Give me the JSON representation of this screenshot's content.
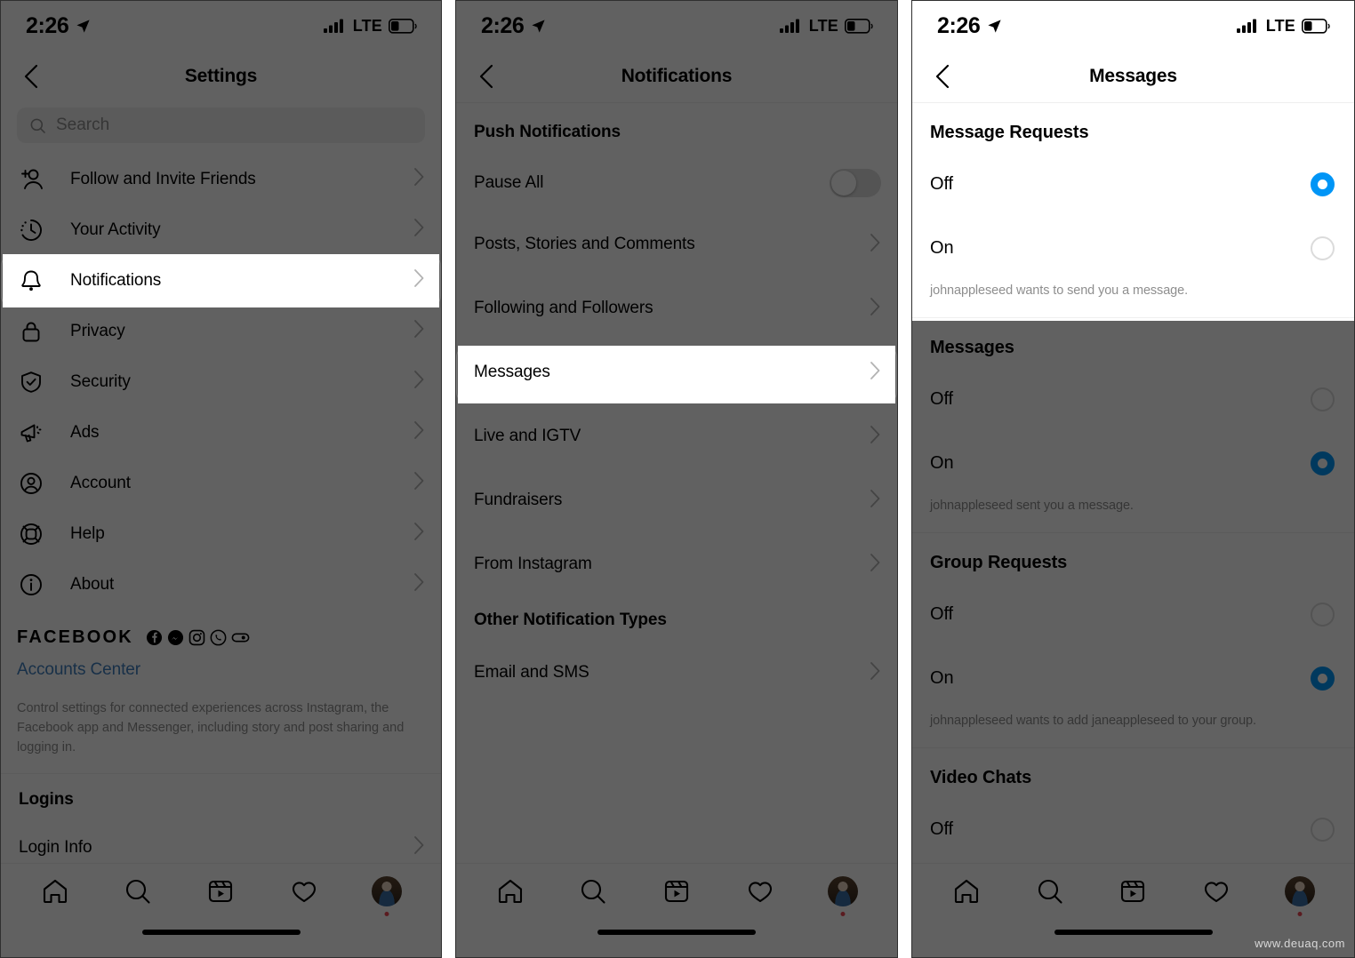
{
  "meta": {
    "watermark": "www.deuaq.com"
  },
  "status_bar": {
    "time": "2:26",
    "network": "LTE",
    "location_icon": "location-arrow-icon",
    "signal_icon": "cellular-signal-icon",
    "battery_icon": "battery-icon"
  },
  "colors": {
    "accent_blue": "#0095f6",
    "link_blue": "#3f7ebd",
    "muted_text": "#8e8e8e",
    "divider": "#efefef",
    "field_bg": "#efefef",
    "notification_dot": "#ed4956",
    "dim_overlay": "#000000"
  },
  "tab_bar": {
    "items": [
      {
        "name": "home",
        "icon": "home-icon"
      },
      {
        "name": "search",
        "icon": "search-icon"
      },
      {
        "name": "reels",
        "icon": "reels-icon"
      },
      {
        "name": "activity",
        "icon": "heart-icon"
      },
      {
        "name": "profile",
        "icon": "avatar-icon",
        "has_badge": true
      }
    ]
  },
  "panel1": {
    "nav": {
      "title": "Settings",
      "back_icon": "chevron-left-icon"
    },
    "search": {
      "placeholder": "Search",
      "icon": "search-icon"
    },
    "items": [
      {
        "label": "Follow and Invite Friends",
        "icon": "add-person-icon",
        "highlighted": false
      },
      {
        "label": "Your Activity",
        "icon": "activity-clock-icon",
        "highlighted": false
      },
      {
        "label": "Notifications",
        "icon": "bell-icon",
        "highlighted": true
      },
      {
        "label": "Privacy",
        "icon": "lock-icon",
        "highlighted": false
      },
      {
        "label": "Security",
        "icon": "shield-check-icon",
        "highlighted": false
      },
      {
        "label": "Ads",
        "icon": "megaphone-icon",
        "highlighted": false
      },
      {
        "label": "Account",
        "icon": "account-circle-icon",
        "highlighted": false
      },
      {
        "label": "Help",
        "icon": "lifebuoy-icon",
        "highlighted": false
      },
      {
        "label": "About",
        "icon": "info-circle-icon",
        "highlighted": false
      }
    ],
    "facebook": {
      "word": "FACEBOOK",
      "icons": [
        "facebook-icon",
        "messenger-icon",
        "instagram-icon",
        "whatsapp-icon",
        "portal-icon"
      ],
      "accounts_center_link": "Accounts Center",
      "description": "Control settings for connected experiences across Instagram, the Facebook app and Messenger, including story and post sharing and logging in."
    },
    "logins": {
      "header": "Logins",
      "items": [
        {
          "label": "Login Info"
        }
      ]
    }
  },
  "panel2": {
    "nav": {
      "title": "Notifications",
      "back_icon": "chevron-left-icon"
    },
    "sections": [
      {
        "header": "Push Notifications",
        "items": [
          {
            "label": "Pause All",
            "control": "toggle",
            "value": "off",
            "highlighted": false
          },
          {
            "label": "Posts, Stories and Comments",
            "control": "chevron",
            "highlighted": false
          },
          {
            "label": "Following and Followers",
            "control": "chevron",
            "highlighted": false
          },
          {
            "label": "Messages",
            "control": "chevron",
            "highlighted": true
          },
          {
            "label": "Live and IGTV",
            "control": "chevron",
            "highlighted": false
          },
          {
            "label": "Fundraisers",
            "control": "chevron",
            "highlighted": false
          },
          {
            "label": "From Instagram",
            "control": "chevron",
            "highlighted": false
          }
        ]
      },
      {
        "header": "Other Notification Types",
        "items": [
          {
            "label": "Email and SMS",
            "control": "chevron",
            "highlighted": false
          }
        ]
      }
    ]
  },
  "panel3": {
    "nav": {
      "title": "Messages",
      "back_icon": "chevron-left-icon"
    },
    "groups": [
      {
        "header": "Message Requests",
        "options": [
          {
            "label": "Off",
            "selected": true
          },
          {
            "label": "On",
            "selected": false
          }
        ],
        "caption": "johnappleseed wants to send you a message.",
        "highlighted": true
      },
      {
        "header": "Messages",
        "options": [
          {
            "label": "Off",
            "selected": false
          },
          {
            "label": "On",
            "selected": true
          }
        ],
        "caption": "johnappleseed sent you a message.",
        "highlighted": false
      },
      {
        "header": "Group Requests",
        "options": [
          {
            "label": "Off",
            "selected": false
          },
          {
            "label": "On",
            "selected": true
          }
        ],
        "caption": "johnappleseed wants to add janeappleseed to your group.",
        "highlighted": false
      },
      {
        "header": "Video Chats",
        "options": [
          {
            "label": "Off",
            "selected": false
          }
        ],
        "caption": "",
        "highlighted": false
      }
    ]
  }
}
